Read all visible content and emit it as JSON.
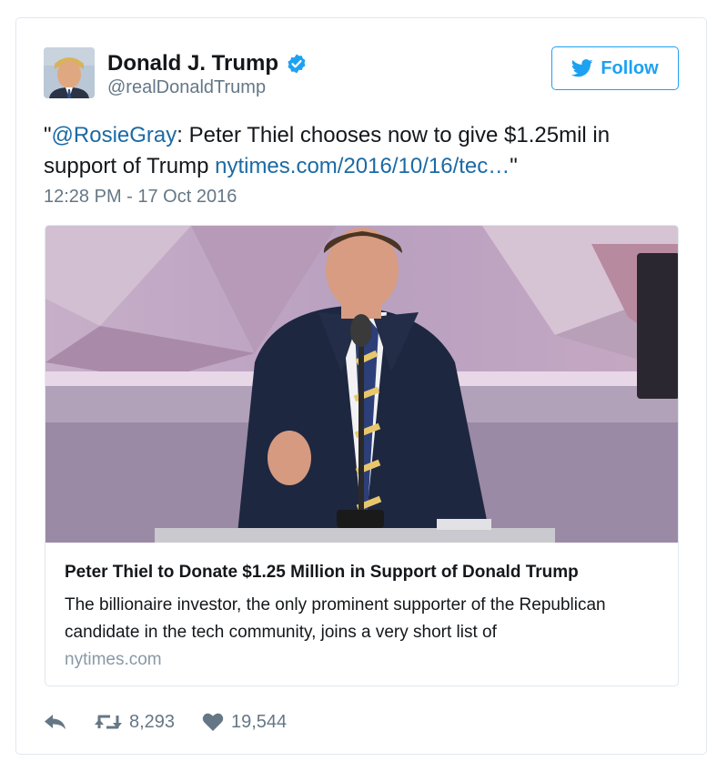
{
  "tweet": {
    "author": {
      "display_name": "Donald J. Trump",
      "screen_name": "@realDonaldTrump",
      "verified": true,
      "avatar_icon": "user-avatar-photo"
    },
    "follow_label": "Follow",
    "text": {
      "prefix": "\"",
      "mention": "@RosieGray",
      "body": ": Peter Thiel chooses now to give $1.25mil in support of Trump ",
      "link": "nytimes.com/2016/10/16/tec…",
      "suffix": "\""
    },
    "timestamp": "12:28 PM - 17 Oct 2016",
    "card": {
      "title": "Peter Thiel to Donate $1.25 Million in Support of Donald Trump",
      "description": "The billionaire investor, the only prominent supporter of the Republican candidate in the tech community, joins a very short list of",
      "domain": "nytimes.com",
      "image_icon": "speaker-at-podium-photo"
    },
    "stats": {
      "retweets": "8,293",
      "likes": "19,544"
    }
  },
  "colors": {
    "twitter_blue": "#1da1f2",
    "link_blue": "#1b6aa5",
    "muted_gray": "#657786",
    "border": "#e1e8ed"
  }
}
